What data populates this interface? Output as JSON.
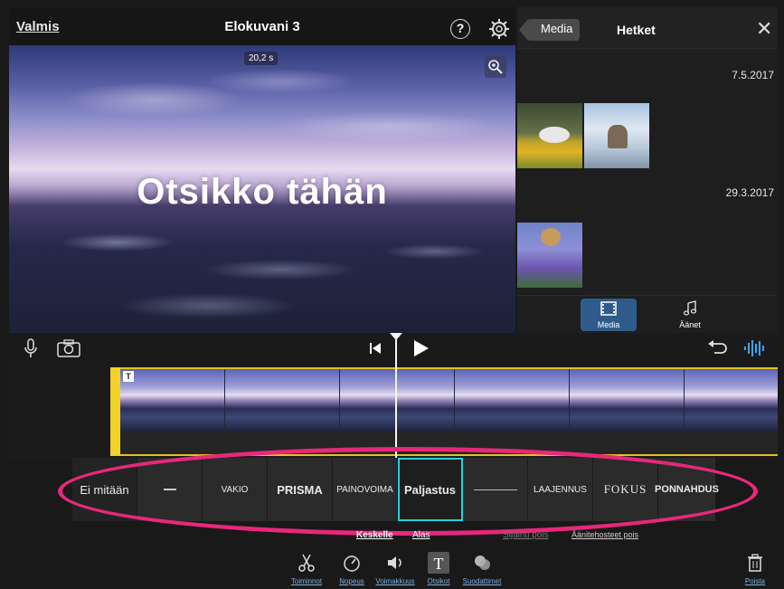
{
  "header": {
    "done_label": "Valmis",
    "project_title": "Elokuvani 3",
    "help_label": "?"
  },
  "viewer": {
    "duration": "20,2 s",
    "title_text": "Otsikko tähän"
  },
  "media_browser": {
    "back_label": "Media",
    "title": "Hetket",
    "close_label": "✕",
    "groups": [
      {
        "date": "7.5.2017"
      },
      {
        "date": "29.3.2017"
      }
    ],
    "tabs": [
      {
        "label": "Media"
      },
      {
        "label": "Äänet"
      }
    ]
  },
  "timeline": {
    "title_marker": "T"
  },
  "title_styles": {
    "items": [
      {
        "label": "Ei mitään"
      },
      {
        "label": ""
      },
      {
        "label": "VAKIO"
      },
      {
        "label": "PRISMA"
      },
      {
        "label": "PAINOVOIMA"
      },
      {
        "label": "Paljastus"
      },
      {
        "label": ""
      },
      {
        "label": "LAAJENNUS"
      },
      {
        "label": "FOKUS"
      },
      {
        "label": "PONNAHDUS"
      }
    ],
    "selected": "Paljastus"
  },
  "options": {
    "center": "Keskelle",
    "down": "Alas",
    "location_off": "Sijainti pois",
    "sound_effects_off": "Äänitehosteet pois"
  },
  "toolbar": {
    "items": [
      {
        "label": "Toiminnot"
      },
      {
        "label": "Nopeus"
      },
      {
        "label": "Voimakkuus"
      },
      {
        "label": "Otsikot"
      },
      {
        "label": "Suodattimet"
      }
    ],
    "delete_label": "Poista"
  },
  "colors": {
    "accent_cyan": "#2ad2dc",
    "highlight_magenta": "#e7287b",
    "clip_yellow": "#f2d228",
    "media_tab_blue": "#2f5b8a"
  }
}
